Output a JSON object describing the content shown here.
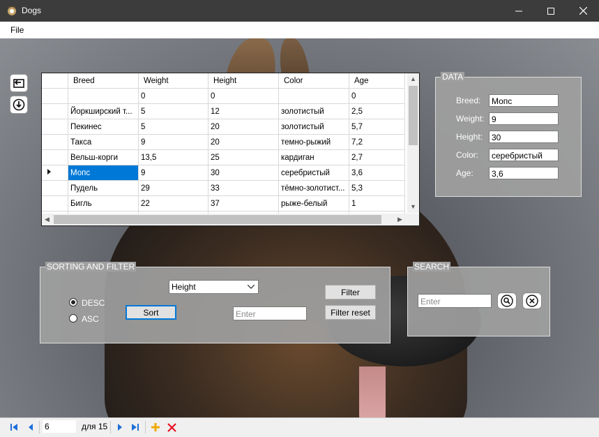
{
  "window": {
    "title": "Dogs"
  },
  "menu": {
    "file": "File"
  },
  "grid": {
    "columns": [
      "Breed",
      "Weight",
      "Height",
      "Color",
      "Age"
    ],
    "rows": [
      [
        "",
        "0",
        "0",
        "",
        "0"
      ],
      [
        "Йоркширский т...",
        "5",
        "12",
        "золотистый",
        "2,5"
      ],
      [
        "Пекинес",
        "5",
        "20",
        "золотистый",
        "5,7"
      ],
      [
        "Такса",
        "9",
        "20",
        "темно-рыжий",
        "7,2"
      ],
      [
        "Вельш-корги",
        "13,5",
        "25",
        "кардиган",
        "2,7"
      ],
      [
        "Мопс",
        "9",
        "30",
        "серебристый",
        "3,6"
      ],
      [
        "Пудель",
        "29",
        "33",
        "тёмно-золотист...",
        "5,3"
      ],
      [
        "Бигль",
        "22",
        "37",
        "рыже-белый",
        "1"
      ],
      [
        "",
        "",
        "",
        "",
        ""
      ]
    ]
  },
  "data_panel": {
    "title": "DATA",
    "breed_label": "Breed:",
    "breed_value": "Мопс",
    "weight_label": "Weight:",
    "weight_value": "9",
    "height_label": "Height:",
    "height_value": "30",
    "color_label": "Color:",
    "color_value": "серебристый",
    "age_label": "Age:",
    "age_value": "3,6"
  },
  "sorting": {
    "title": "SORTING AND FILTER",
    "desc_label": "DESC",
    "asc_label": "ASC",
    "selected_order": "DESC",
    "sort_button": "Sort",
    "field_selected": "Height",
    "filter_placeholder": "Enter",
    "filter_button": "Filter",
    "filter_reset_button": "Filter reset"
  },
  "search": {
    "title": "SEARCH",
    "placeholder": "Enter"
  },
  "navigator": {
    "position": "6",
    "count_text": "для 15"
  },
  "colors": {
    "selection": "#0078d7",
    "delete": "#e81123",
    "add": "#f0a800",
    "nav": "#1e6fd9"
  }
}
